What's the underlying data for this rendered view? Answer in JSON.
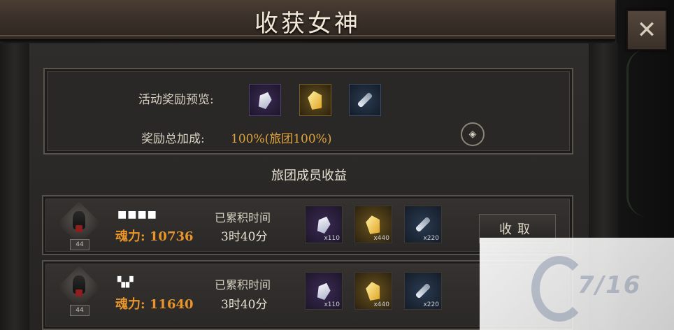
{
  "title": "收获女神",
  "close_label": "✕",
  "preview": {
    "label": "活动奖励预览:",
    "items": [
      {
        "icon": "white-crystal-icon",
        "color": "#4f3f70"
      },
      {
        "icon": "gold-crystal-icon",
        "color": "#7a5f22"
      },
      {
        "icon": "tool-icon",
        "color": "#384b66"
      }
    ],
    "bonus_label": "奖励总加成:",
    "bonus_value": "100%(旅团100%)",
    "info_icon": "info-icon"
  },
  "section_title": "旅团成员收益",
  "members": [
    {
      "name": "■■■■",
      "level": "44",
      "power": "魂力: 10736",
      "time_label": "已累积时间",
      "time_value": "3时40分",
      "rewards": [
        {
          "icon": "white-crystal-icon",
          "qty": "x110"
        },
        {
          "icon": "gold-crystal-icon",
          "qty": "x440"
        },
        {
          "icon": "tool-icon",
          "qty": "x220"
        }
      ]
    },
    {
      "name": "▚▞",
      "level": "44",
      "power": "魂力: 11640",
      "time_label": "已累积时间",
      "time_value": "3时40分",
      "rewards": [
        {
          "icon": "white-crystal-icon",
          "qty": "x110"
        },
        {
          "icon": "gold-crystal-icon",
          "qty": "x440"
        },
        {
          "icon": "tool-icon",
          "qty": "x220"
        }
      ]
    }
  ],
  "collect_button": "收取",
  "watermark": "7/16"
}
